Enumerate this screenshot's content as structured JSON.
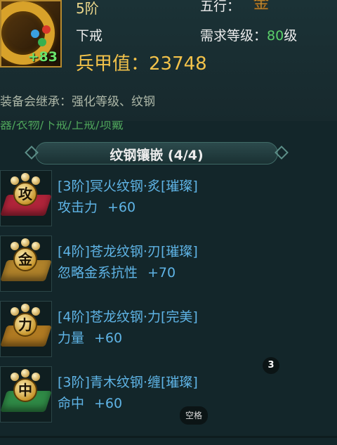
{
  "item": {
    "tier": "5阶",
    "slot": "下戒",
    "element_label": "五行：",
    "element_value": "金",
    "level_label": "需求等级：",
    "level_value": "80",
    "level_unit": "级",
    "enhance": "+83",
    "power_label": "兵甲值：",
    "power_value": "23748",
    "inherit_note": "装备会继承：强化等级、纹钢",
    "set_parts_cut": "器/衣物/下戒/上戒/项戴"
  },
  "section": {
    "title": "纹钢镶嵌 (4/4)"
  },
  "gems": [
    {
      "glyph": "攻",
      "name": "[3阶]冥火纹钢·炙[璀璨]",
      "stat": "攻击力",
      "value": "+60",
      "color": "#b0243a"
    },
    {
      "glyph": "金",
      "name": "[4阶]苍龙纹钢·刃[璀璨]",
      "stat": "忽略金系抗性",
      "value": "+70",
      "color": "#b0822a"
    },
    {
      "glyph": "力",
      "name": "[4阶]苍龙纹钢·力[完美]",
      "stat": "力量",
      "value": "+60",
      "color": "#b07a22"
    },
    {
      "glyph": "中",
      "name": "[3阶]青木纹钢·缠[璀璨]",
      "stat": "命中",
      "value": "+60",
      "color": "#2f8a46"
    }
  ],
  "overlay": {
    "badge": "3",
    "space_hint": "空格"
  },
  "colors": {
    "gem_text": "#5fb4e6",
    "level": "#5ad06a",
    "power": "#f2c24a",
    "enhance": "#6be36a"
  }
}
